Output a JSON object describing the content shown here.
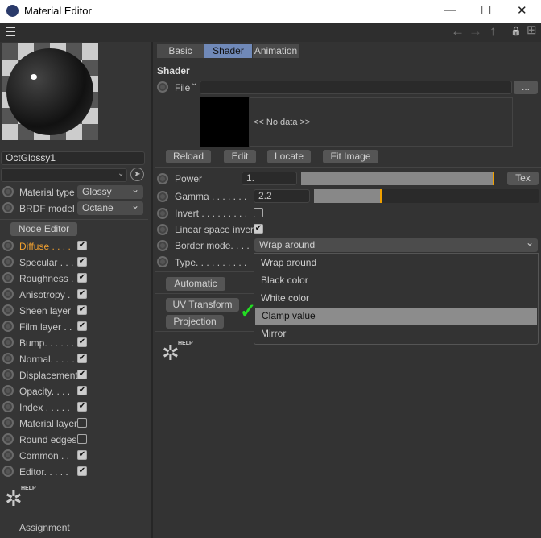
{
  "window": {
    "title": "Material Editor",
    "minimize": "—",
    "maximize": "☐",
    "close": "✕"
  },
  "toolbar": {
    "menu_icon": "☰",
    "back": "←",
    "forward": "→",
    "up": "↑",
    "lock": "🔒",
    "new": "⊞"
  },
  "material": {
    "name": "OctGlossy1",
    "material_type_label": "Material type",
    "material_type": "Glossy",
    "brdf_label": "BRDF model",
    "brdf": "Octane",
    "node_editor": "Node Editor"
  },
  "channels": [
    {
      "label": "Diffuse . . . .",
      "checked": true,
      "active": true
    },
    {
      "label": "Specular . . .",
      "checked": true
    },
    {
      "label": "Roughness .",
      "checked": true
    },
    {
      "label": "Anisotropy .",
      "checked": true
    },
    {
      "label": "Sheen layer",
      "checked": true
    },
    {
      "label": "Film layer . .",
      "checked": true
    },
    {
      "label": "Bump. . . . . .",
      "checked": true
    },
    {
      "label": "Normal. . . . .",
      "checked": true
    },
    {
      "label": "Displacement",
      "checked": true
    },
    {
      "label": "Opacity. . . .",
      "checked": true
    },
    {
      "label": "Index . . . . .",
      "checked": true
    },
    {
      "label": "Material layer",
      "checked": false
    },
    {
      "label": "Round edges",
      "checked": false
    },
    {
      "label": "Common . .",
      "checked": true
    },
    {
      "label": "Editor. . . . .",
      "checked": true
    }
  ],
  "left_footer": {
    "help": "HELP",
    "assignment": "Assignment"
  },
  "tabs": [
    {
      "label": "Basic"
    },
    {
      "label": "Shader",
      "active": true
    },
    {
      "label": "Animation"
    }
  ],
  "shader": {
    "heading": "Shader",
    "file_label": "File",
    "file_value": "",
    "browse": "...",
    "no_data": "<< No data >>",
    "buttons": [
      "Reload",
      "Edit",
      "Locate",
      "Fit Image"
    ],
    "power_label": "Power",
    "power_value": "1.",
    "power_slider": 1.0,
    "tex": "Tex",
    "gamma_label": "Gamma . . . . . . .",
    "gamma_value": "2.2",
    "gamma_slider": 0.3,
    "invert_label": "Invert . . . . . . . . .",
    "invert": false,
    "linear_label": "Linear space invert",
    "linear": true,
    "border_label": "Border mode. . . .",
    "border_value": "Wrap around",
    "type_label": "Type. . . . . . . . . .",
    "automatic": "Automatic",
    "uv_transform": "UV Transform",
    "projection": "Projection",
    "help": "HELP",
    "dropdown_options": [
      "Wrap around",
      "Black color",
      "White color",
      "Clamp value",
      "Mirror"
    ],
    "highlighted": "Clamp value"
  },
  "colors": {
    "accent": "#f0a000",
    "tab_active": "#7089b8",
    "check": "#22dd22",
    "active_label": "#f0a030"
  }
}
